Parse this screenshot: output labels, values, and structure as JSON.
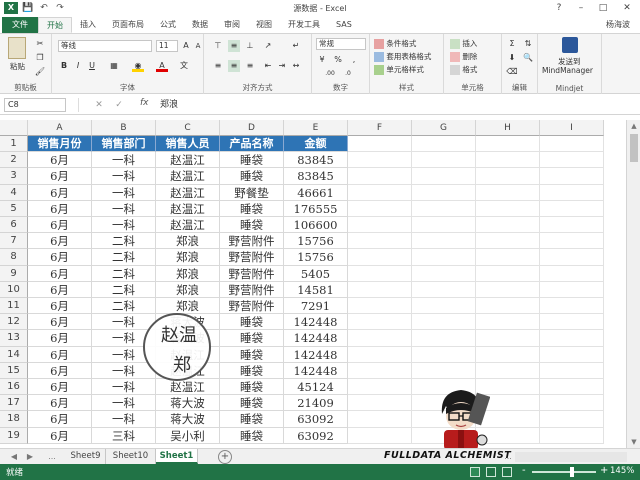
{
  "window": {
    "title": "源数据 - Excel",
    "user": "杨海波",
    "quick_access": [
      "save-icon",
      "undo-icon",
      "redo-icon"
    ]
  },
  "ribbon_tabs": [
    "文件",
    "开始",
    "插入",
    "页面布局",
    "公式",
    "数据",
    "审阅",
    "视图",
    "开发工具",
    "SAS"
  ],
  "ribbon": {
    "clipboard": {
      "paste": "粘贴",
      "label": "剪贴板"
    },
    "font": {
      "name": "等线",
      "size": "11",
      "label": "字体"
    },
    "alignment": {
      "label": "对齐方式"
    },
    "number": {
      "format": "常规",
      "label": "数字"
    },
    "styles": {
      "conditional": "条件格式",
      "table": "套用表格格式",
      "cell": "单元格样式",
      "label": "样式"
    },
    "cells": {
      "insert": "插入",
      "delete": "删除",
      "format": "格式",
      "label": "单元格"
    },
    "editing": {
      "label": "编辑"
    },
    "mindjet": {
      "line1": "发送到",
      "line2": "MindManager",
      "label": "Mindjet"
    }
  },
  "formula_bar": {
    "name_box": "C8",
    "fx": "fx",
    "value": "郑浪"
  },
  "columns": [
    "A",
    "B",
    "C",
    "D",
    "E",
    "F",
    "G",
    "H",
    "I"
  ],
  "table": {
    "headers": [
      "销售月份",
      "销售部门",
      "销售人员",
      "产品名称",
      "金额"
    ],
    "rows": [
      [
        "6月",
        "一科",
        "赵温江",
        "睡袋",
        "83845"
      ],
      [
        "6月",
        "一科",
        "赵温江",
        "睡袋",
        "83845"
      ],
      [
        "6月",
        "一科",
        "赵温江",
        "野餐垫",
        "46661"
      ],
      [
        "6月",
        "一科",
        "赵温江",
        "睡袋",
        "176555"
      ],
      [
        "6月",
        "一科",
        "赵温江",
        "睡袋",
        "106600"
      ],
      [
        "6月",
        "二科",
        "郑浪",
        "野营附件",
        "15756"
      ],
      [
        "6月",
        "二科",
        "郑浪",
        "野营附件",
        "15756"
      ],
      [
        "6月",
        "二科",
        "郑浪",
        "野营附件",
        "5405"
      ],
      [
        "6月",
        "二科",
        "郑浪",
        "野营附件",
        "14581"
      ],
      [
        "6月",
        "二科",
        "郑浪",
        "野营附件",
        "7291"
      ],
      [
        "6月",
        "一科",
        "蒋大波",
        "睡袋",
        "142448"
      ],
      [
        "6月",
        "一科",
        "蒋大波",
        "睡袋",
        "142448"
      ],
      [
        "6月",
        "一科",
        "赵温江",
        "睡袋",
        "142448"
      ],
      [
        "6月",
        "一科",
        "赵温江",
        "睡袋",
        "142448"
      ],
      [
        "6月",
        "一科",
        "赵温江",
        "睡袋",
        "45124"
      ],
      [
        "6月",
        "一科",
        "蒋大波",
        "睡袋",
        "21409"
      ],
      [
        "6月",
        "一科",
        "蒋大波",
        "睡袋",
        "63092"
      ],
      [
        "6月",
        "三科",
        "吴小利",
        "睡袋",
        "63092"
      ]
    ]
  },
  "magnifier": {
    "line1": "赵温",
    "line2": "郑"
  },
  "sheets": {
    "tabs": [
      "Sheet9",
      "Sheet10",
      "Sheet1"
    ],
    "active": "Sheet1",
    "ellipsis": "..."
  },
  "watermark": "FULLDATA ALCHEMIST",
  "status": {
    "ready": "就绪",
    "zoom": "145%",
    "zoom_minus": "-",
    "zoom_plus": "+"
  },
  "colors": {
    "excel_green": "#217346",
    "header_blue": "#2e74b5"
  }
}
